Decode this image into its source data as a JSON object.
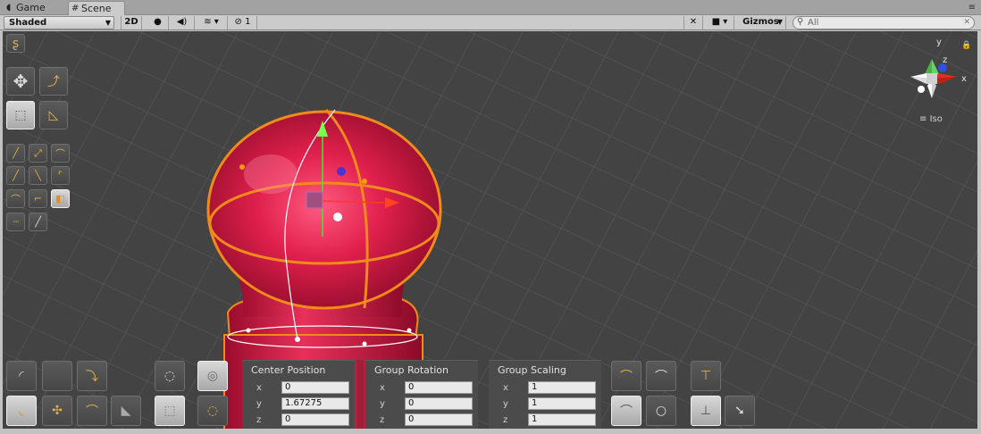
{
  "tabs": {
    "game": "Game",
    "scene": "Scene"
  },
  "toolbar": {
    "shading_mode": "Shaded",
    "mode_2d": "2D",
    "layer_count": "1",
    "gizmos": "Gizmos",
    "search_placeholder": "All"
  },
  "gizmo": {
    "x": "x",
    "y": "y",
    "z": "z",
    "projection": "Iso"
  },
  "center_position": {
    "title": "Center Position",
    "x_label": "x",
    "y_label": "y",
    "z_label": "z",
    "x": "0",
    "y": "1.67275",
    "z": "0"
  },
  "group_rotation": {
    "title": "Group Rotation",
    "x_label": "x",
    "y_label": "y",
    "z_label": "z",
    "x": "0",
    "y": "0",
    "z": "0"
  },
  "group_scaling": {
    "title": "Group Scaling",
    "x_label": "x",
    "y_label": "y",
    "z_label": "z",
    "x": "1",
    "y": "1",
    "z": "1"
  },
  "colors": {
    "accent": "#f08a1a",
    "object": "#d81e4a",
    "viewport": "#434343"
  }
}
